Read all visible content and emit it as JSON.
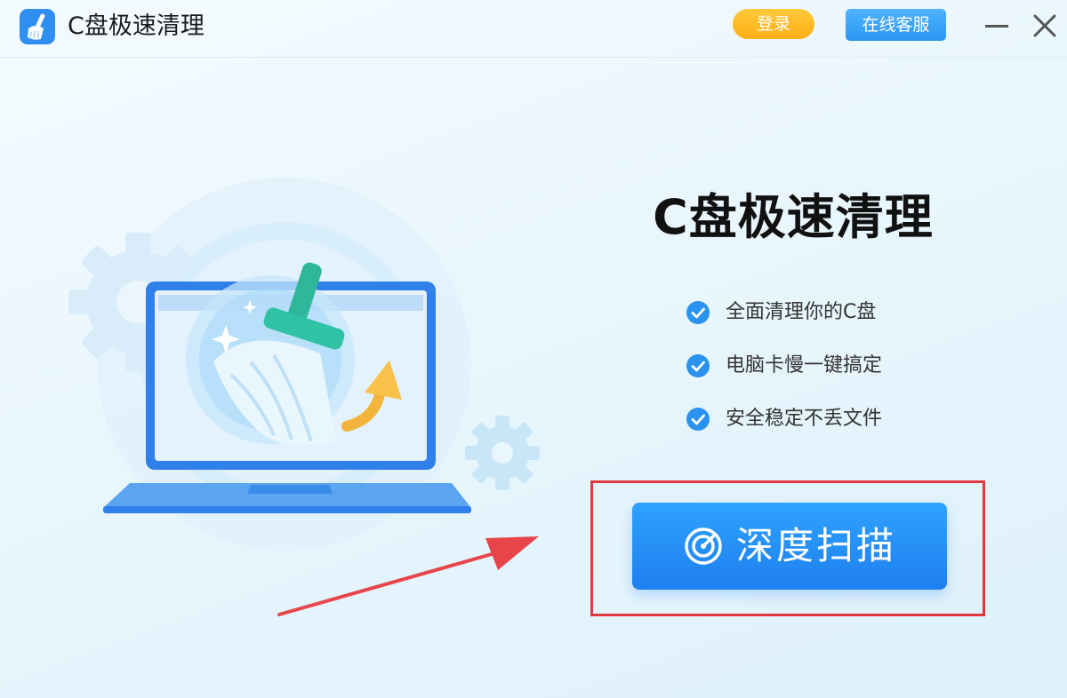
{
  "titlebar": {
    "app_title": "C盘极速清理",
    "login_label": "登录",
    "service_label": "在线客服",
    "logo_icon": "broom-icon",
    "minimize_icon": "minimize-icon",
    "close_icon": "close-icon"
  },
  "main": {
    "headline": "C盘极速清理",
    "features": [
      {
        "text": "全面清理你的C盘",
        "icon": "check-circle-icon"
      },
      {
        "text": "电脑卡慢一键搞定",
        "icon": "check-circle-icon"
      },
      {
        "text": "安全稳定不丢文件",
        "icon": "check-circle-icon"
      }
    ],
    "scan_button": {
      "label": "深度扫描",
      "icon": "radar-scan-icon"
    }
  },
  "colors": {
    "accent_blue": "#1e7fee",
    "login_orange": "#ffae18",
    "highlight_red": "#e0393e",
    "check_blue": "#2a93ef"
  }
}
